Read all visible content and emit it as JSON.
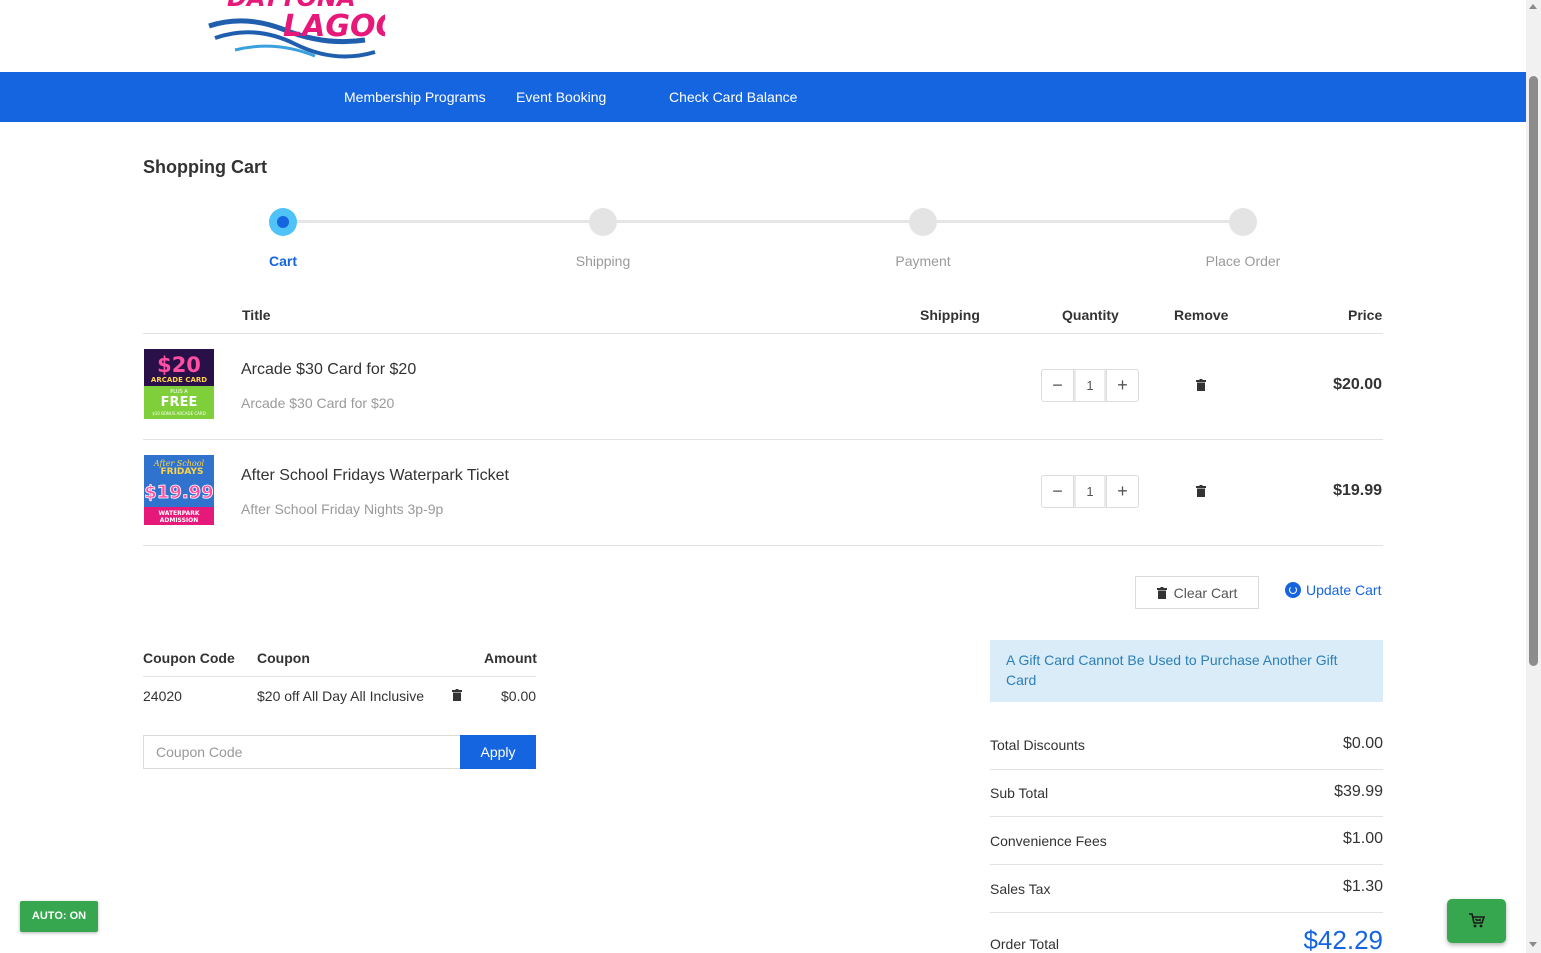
{
  "brand": {
    "logo_line1": "DAYTONA",
    "logo_line2": "LAGOON"
  },
  "nav": {
    "items": [
      "Membership Programs",
      "Event Booking",
      "Check Card Balance"
    ]
  },
  "page": {
    "title": "Shopping Cart"
  },
  "steps": [
    {
      "label": "Cart",
      "active": true
    },
    {
      "label": "Shipping",
      "active": false
    },
    {
      "label": "Payment",
      "active": false
    },
    {
      "label": "Place Order",
      "active": false
    }
  ],
  "cart": {
    "headers": {
      "title": "Title",
      "shipping": "Shipping",
      "quantity": "Quantity",
      "remove": "Remove",
      "price": "Price"
    },
    "items": [
      {
        "title": "Arcade $30 Card for $20",
        "subtitle": "Arcade $30 Card for $20",
        "quantity": "1",
        "price": "$20.00",
        "thumb": {
          "top": "$20",
          "mid": "ARCADE CARD",
          "small": "PLUS A",
          "free": "FREE",
          "bottom": "$10 BONUS ARCADE CARD"
        }
      },
      {
        "title": "After School Fridays Waterpark Ticket",
        "subtitle": "After School Friday Nights 3p-9p",
        "quantity": "1",
        "price": "$19.99",
        "thumb": {
          "script": "After School",
          "fridays": "FRIDAYS",
          "price": "$19.99",
          "bottom1": "WATERPARK",
          "bottom2": "ADMISSION"
        }
      }
    ],
    "qty_minus": "−",
    "qty_plus": "+",
    "clear_label": "Clear Cart",
    "update_label": "Update Cart"
  },
  "coupons": {
    "headers": {
      "code": "Coupon Code",
      "coupon": "Coupon",
      "amount": "Amount"
    },
    "rows": [
      {
        "code": "24020",
        "coupon": "$20 off All Day All Inclusive",
        "amount": "$0.00"
      }
    ],
    "input_placeholder": "Coupon Code",
    "apply_label": "Apply"
  },
  "summary": {
    "notice": "A Gift Card Cannot Be Used to Purchase Another Gift Card",
    "rows": [
      {
        "label": "Total Discounts",
        "value": "$0.00"
      },
      {
        "label": "Sub Total",
        "value": "$39.99"
      },
      {
        "label": "Convenience Fees",
        "value": "$1.00"
      },
      {
        "label": "Sales Tax",
        "value": "$1.30"
      }
    ],
    "total_label": "Order Total",
    "total_value": "$42.29"
  },
  "badges": {
    "auto": "AUTO: ON"
  },
  "colors": {
    "nav": "#1565e0",
    "accent": "#1565e0",
    "badge_green": "#36a64f",
    "notice_bg": "#d9ecf7"
  }
}
